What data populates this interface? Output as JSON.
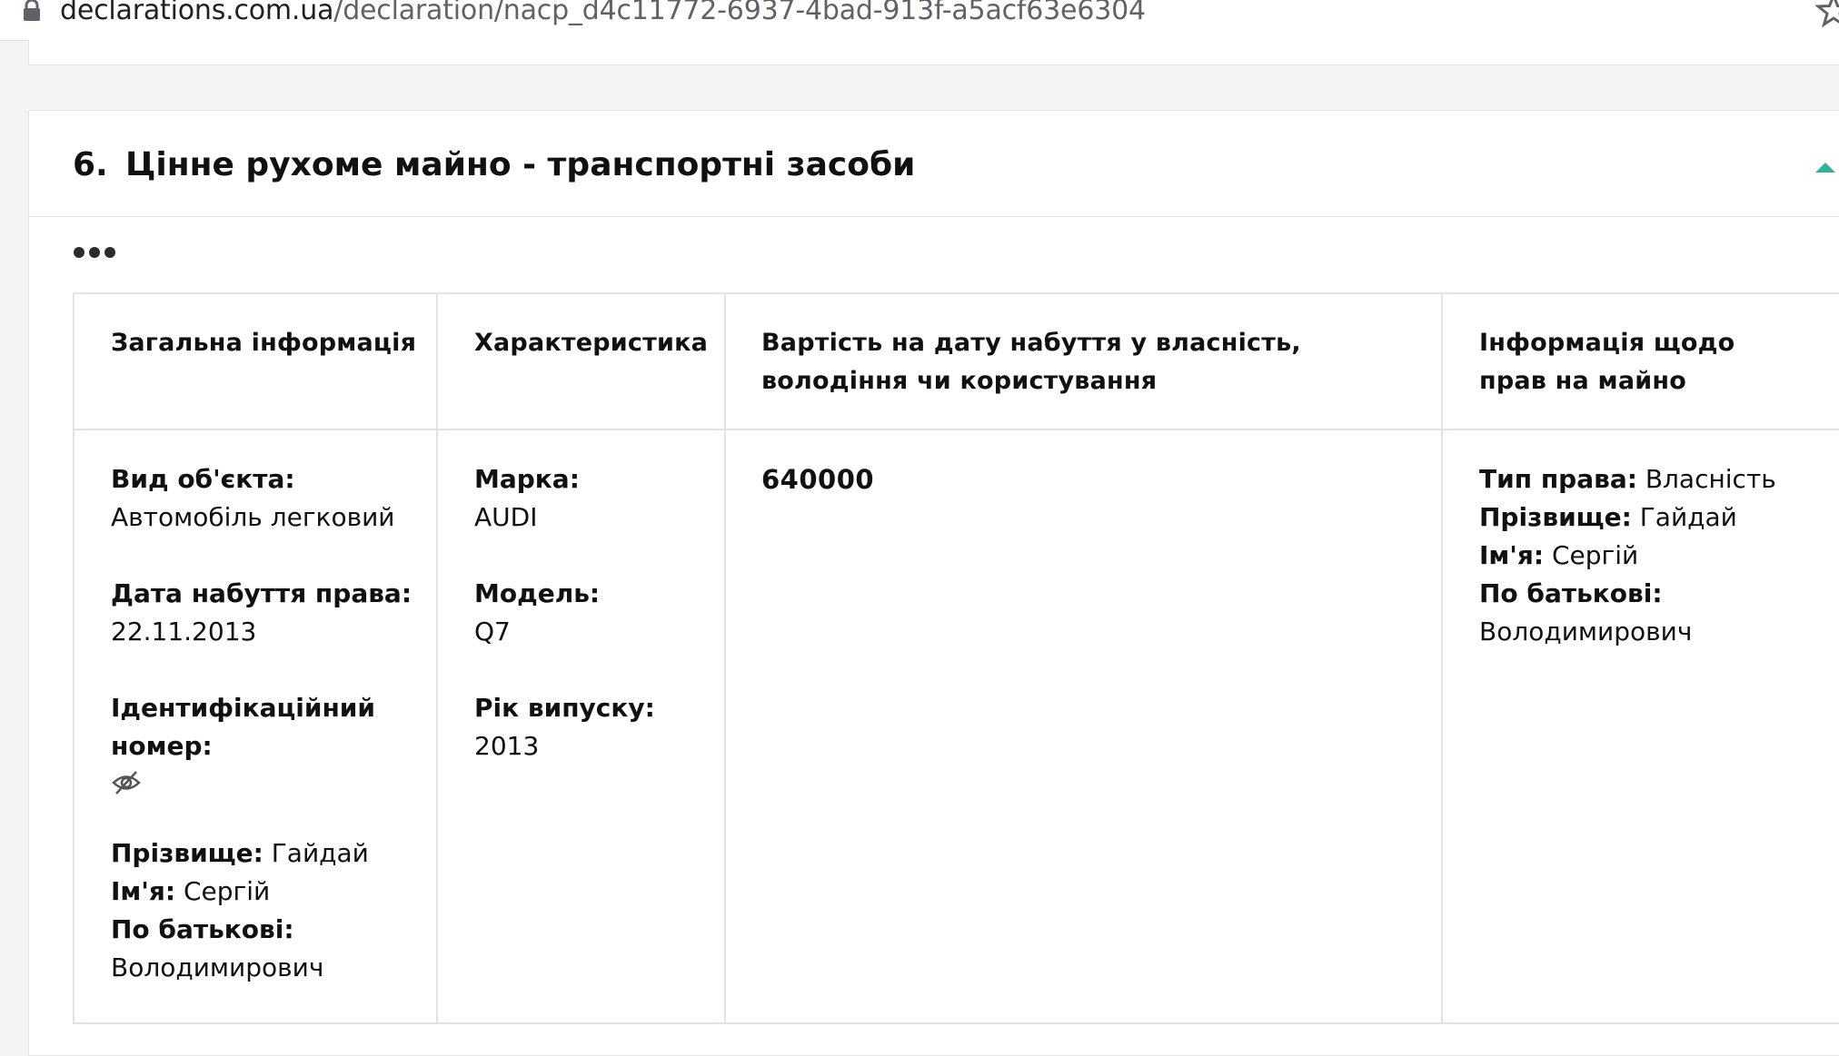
{
  "browser": {
    "url_host": "declarations.com.ua",
    "url_path": "/declaration/nacp_d4c11772-6937-4bad-913f-a5acf63e6304",
    "lock_icon": "lock-icon",
    "star_icon": "star-icon"
  },
  "section": {
    "number": "6.",
    "title": "Цінне рухоме майно - транспортні засоби",
    "collapse_icon": "caret-up-icon",
    "more_icon": "more-dots-icon",
    "accent_color": "#2fb3a0"
  },
  "table": {
    "headers": [
      "Загальна інформація",
      "Характеристика",
      "Вартість на дату набуття у власність, володіння чи користування",
      "Інформація щодо прав на майно"
    ],
    "row": {
      "general": {
        "object_type_label": "Вид об'єкта:",
        "object_type_value": "Автомобіль легковий",
        "acq_date_label": "Дата набуття права:",
        "acq_date_value": "22.11.2013",
        "id_label": "Ідентифікаційний номер:",
        "id_icon": "hidden-eye-icon",
        "surname_label": "Прізвище:",
        "surname_value": "Гайдай",
        "name_label": "Ім'я:",
        "name_value": "Сергій",
        "patronymic_label": "По батькові:",
        "patronymic_value": "Володимирович"
      },
      "characteristics": {
        "brand_label": "Марка:",
        "brand_value": "AUDI",
        "model_label": "Модель:",
        "model_value": "Q7",
        "year_label": "Рік випуску:",
        "year_value": "2013"
      },
      "cost": "640000",
      "rights": {
        "type_label": "Тип права:",
        "type_value": "Власність",
        "surname_label": "Прізвище:",
        "surname_value": "Гайдай",
        "name_label": "Ім'я:",
        "name_value": "Сергій",
        "patronymic_label": "По батькові:",
        "patronymic_value": "Володимирович"
      }
    }
  }
}
